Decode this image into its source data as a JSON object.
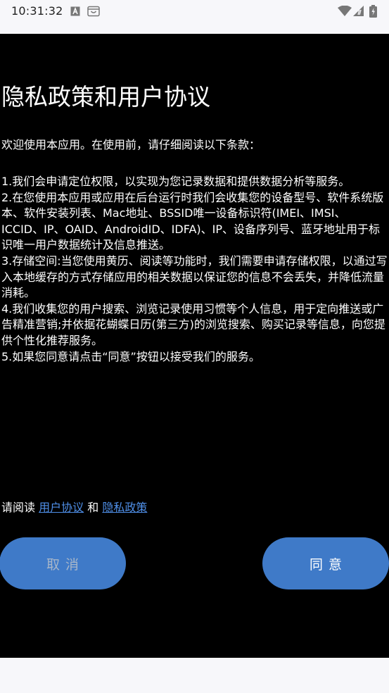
{
  "status_bar": {
    "time": "10:31:32",
    "icons": [
      "a-notification-icon",
      "calendar-notification-icon",
      "wifi-icon",
      "signal-icon",
      "battery-charging-icon"
    ]
  },
  "dialog": {
    "title": "隐私政策和用户协议",
    "intro": "欢迎使用本应用。在使用前，请仔细阅读以下条款：",
    "items": [
      "1.我们会申请定位权限，以实现为您记录数据和提供数据分析等服务。",
      "2.在您使用本应用或应用在后台运行时我们会收集您的设备型号、软件系统版本、软件安装列表、Mac地址、BSSID唯一设备标识符(IMEI、IMSI、ICCID、IP、OAID、AndroidID、IDFA)、IP、设备序列号、蓝牙地址用于标识唯一用户数据统计及信息推送。",
      "3.存储空间:当您使用黄历、阅读等功能时，我们需要申请存储权限，以通过写入本地缓存的方式存储应用的相关数据以保证您的信息不会丢失，并降低流量消耗。",
      "4.我们收集您的用户搜索、浏览记录使用习惯等个人信息，用于定向推送或广告精准营销;并依据花蝴蝶日历(第三方)的浏览搜索、购买记录等信息，向您提供个性化推荐服务。",
      "5.如果您同意请点击“同意”按钮以接受我们的服务。"
    ],
    "read_prefix": "请阅读",
    "user_agreement_link": "用户协议",
    "and_text": "和",
    "privacy_policy_link": "隐私政策",
    "cancel_label": "取消",
    "agree_label": "同意"
  },
  "colors": {
    "background": "#000000",
    "status_bar": "#f7f7fa",
    "link": "#4f8fe8",
    "button": "#3f7ac8",
    "cancel_text": "#a7b6c9"
  }
}
